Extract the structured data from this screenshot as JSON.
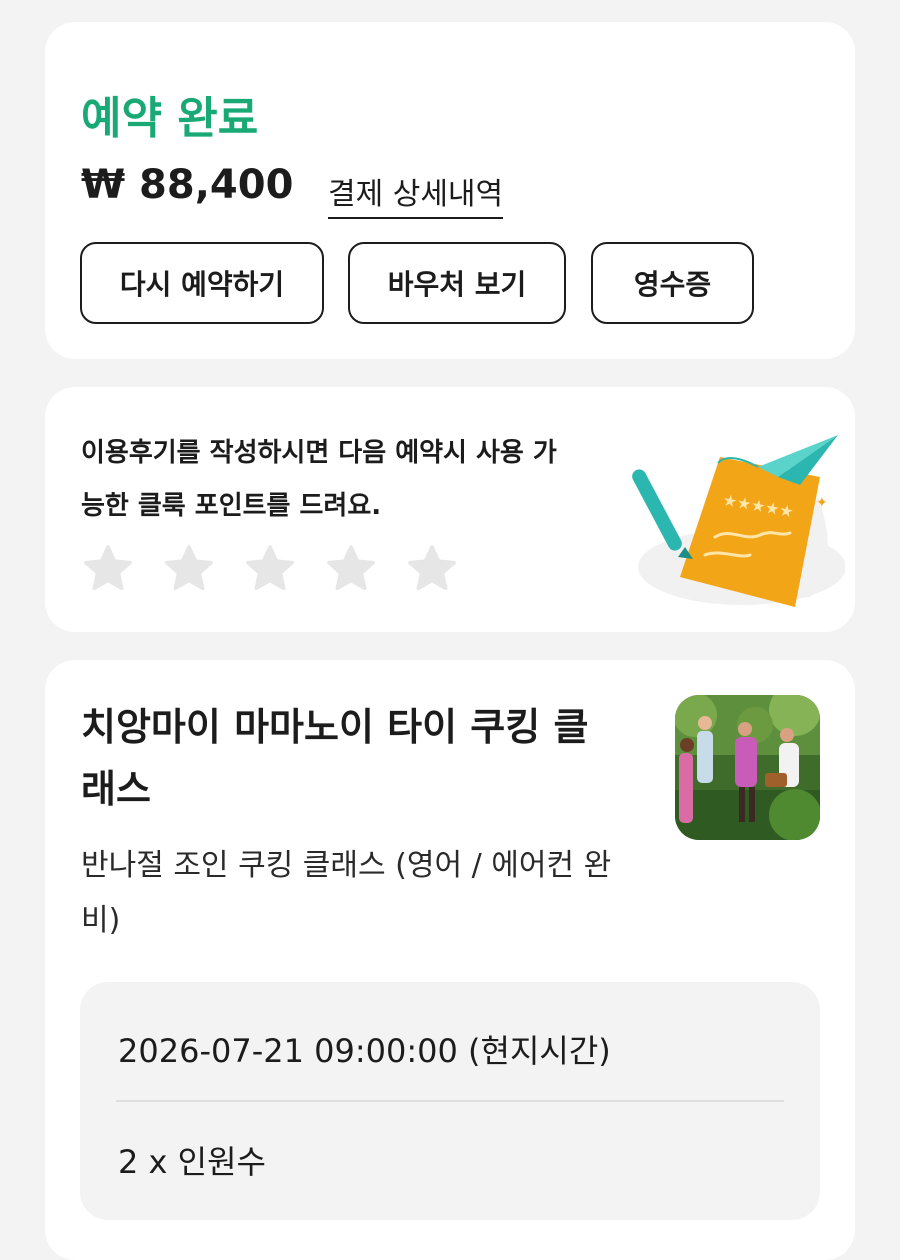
{
  "status": {
    "title": "예약 완료",
    "price": "₩ 88,400",
    "detail_link": "결제 상세내역",
    "buttons": {
      "rebook": "다시 예약하기",
      "voucher": "바우처 보기",
      "receipt": "영수증"
    },
    "accent_color": "#19a974"
  },
  "review": {
    "message_line1": "이용후기를 작성하시면 다음 예약시 사용 가",
    "message_line2": "능한 클룩 포인트를 드려요.",
    "star_count": 5,
    "star_color": "#e6e6e6",
    "illustration": "review-paper-plane-illustration"
  },
  "product": {
    "title": "치앙마이 마마노이 타이 쿠킹 클래스",
    "option": "반나절 조인 쿠킹 클래스 (영어 / 에어컨 완비)",
    "thumbnail": "cooking-class-photo",
    "datetime": "2026-07-21 09:00:00 (현지시간)",
    "participants": "2 x 인원수"
  }
}
